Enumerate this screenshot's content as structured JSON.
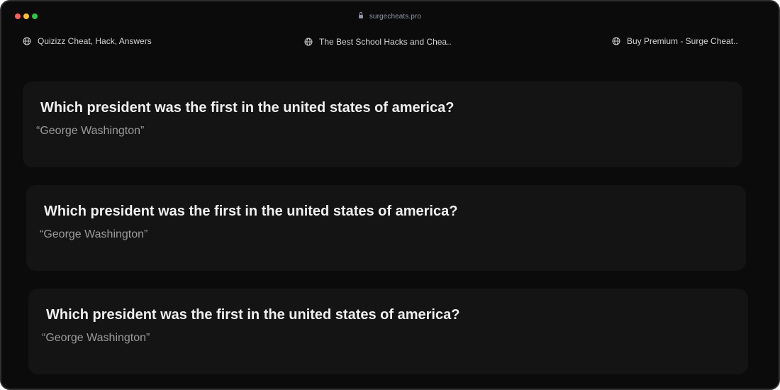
{
  "browser": {
    "url": "surgecheats.pro",
    "controls": [
      "close",
      "minimize",
      "maximize"
    ]
  },
  "tabs": [
    {
      "label": "Quizizz Cheat, Hack, Answers",
      "icon": "globe-icon"
    },
    {
      "label": "The Best School Hacks and Chea..",
      "icon": "globe-icon"
    },
    {
      "label": "Buy Premium - Surge Cheat..",
      "icon": "globe-icon"
    }
  ],
  "cards": [
    {
      "question": "Which president was the first in the united states of america?",
      "answer": "“George Washington”"
    },
    {
      "question": "Which president was the first in the united states of america?",
      "answer": "“George Washington”"
    },
    {
      "question": "Which president was the first in the united states of america?",
      "answer": "“George Washington”"
    }
  ],
  "colors": {
    "background": "#0b0b0b",
    "card": "#141414",
    "question_text": "#efefef",
    "answer_text": "#9a9a9a",
    "close": "#ff5f57",
    "minimize": "#febc2e",
    "maximize": "#28c840"
  }
}
